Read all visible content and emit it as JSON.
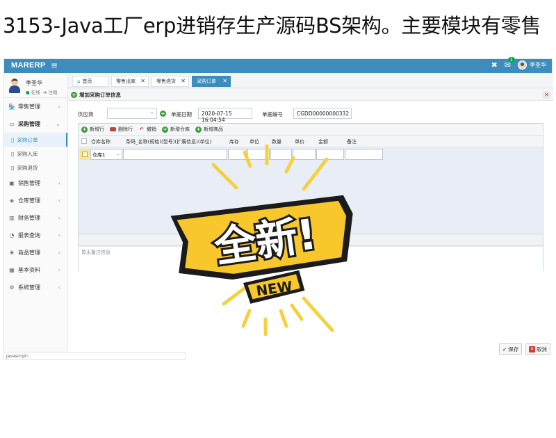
{
  "page_heading": "3153-Java工厂erp进销存生产源码BS架构。主要模块有零售",
  "app": {
    "brand": "MARERP",
    "menu_icon": "hamburger-icon",
    "notifications_count": "1",
    "user_name": "李圣华"
  },
  "sidebar": {
    "user_name": "李圣华",
    "status_online": "在线",
    "status_logout": "注销",
    "items": [
      {
        "label": "零售管理",
        "icon": "shop-icon"
      },
      {
        "label": "采购管理",
        "icon": "monitor-icon"
      },
      {
        "label": "销售管理",
        "icon": "sales-icon"
      },
      {
        "label": "仓库管理",
        "icon": "warehouse-icon"
      },
      {
        "label": "财务管理",
        "icon": "finance-icon"
      },
      {
        "label": "报表查询",
        "icon": "report-icon"
      },
      {
        "label": "商品管理",
        "icon": "goods-icon"
      },
      {
        "label": "基本资料",
        "icon": "grid-icon"
      },
      {
        "label": "系统管理",
        "icon": "settings-icon"
      }
    ],
    "purchase_sub": [
      "采购订单",
      "采购入库",
      "采购退货"
    ]
  },
  "tabs": [
    {
      "label": "首页"
    },
    {
      "label": "零售出库"
    },
    {
      "label": "零售退货"
    },
    {
      "label": "采购订单"
    }
  ],
  "panel": {
    "title": "增加采购订单信息"
  },
  "form": {
    "supplier_label": "供应商",
    "supplier_value": "",
    "date_label": "单据日期",
    "date_value": "2020-07-15 16:04:54",
    "number_label": "单据编号",
    "number_value": "CGDD00000000332"
  },
  "toolbar": {
    "add_row": "新增行",
    "delete_row": "删除行",
    "undo": "撤销",
    "add_warehouse": "新增仓库",
    "add_goods": "新增商品"
  },
  "grid": {
    "columns": [
      "仓库名称",
      "条码_名称(规格)(型号)(扩展信息)(单位)",
      "库存",
      "单位",
      "数量",
      "单价",
      "金额",
      "备注"
    ],
    "row": {
      "warehouse": "仓库1"
    },
    "remarks_placeholder": "暂无备注信息"
  },
  "footer": {
    "save": "保存",
    "cancel": "取消",
    "status_text": "javascript:;"
  },
  "sticker": {
    "main_text": "全新!",
    "sub_text": "NEW",
    "colors": {
      "yellow": "#f7c72b",
      "dark": "#1b1b1b",
      "ray": "#f4d23c"
    }
  }
}
